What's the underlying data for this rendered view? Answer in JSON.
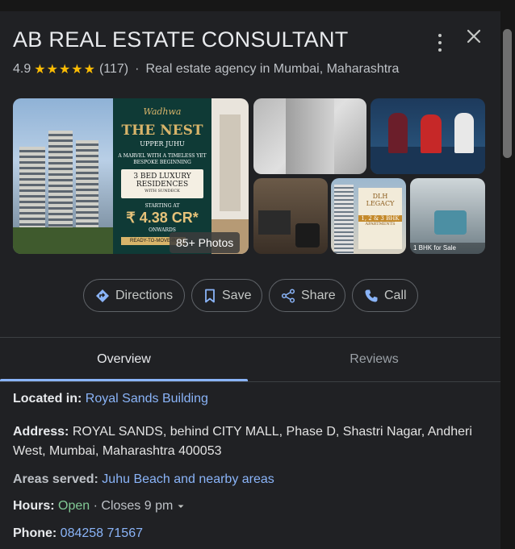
{
  "place": {
    "name": "AB REAL ESTATE CONSULTANT",
    "rating": "4.9",
    "stars": "★★★★★",
    "review_count": "(117)",
    "separator": "·",
    "category": "Real estate agency in Mumbai, Maharashtra"
  },
  "photos": {
    "count_label": "85+ Photos",
    "main": {
      "brand": "Wadhwa",
      "project": "THE NEST",
      "location": "UPPER JUHU",
      "tagline_1": "A MARVEL WITH A TIMELESS YET",
      "tagline_2": "BESPOKE BEGINNING",
      "box_line_1": "3 BED LUXURY",
      "box_line_2": "RESIDENCES",
      "box_line_3": "WITH SUNDECK",
      "starting_at": "STARTING AT",
      "price": "₹ 4.38 CR*",
      "onwards": "ONWARDS",
      "ready": "READY-TO-MOVE-IN"
    },
    "dlh": {
      "title_1": "DLH",
      "title_2": "LEGACY",
      "line": "1, 2 & 3 BHK",
      "sub": "APARTMENTS"
    },
    "room_caption": "1 BHK for Sale"
  },
  "actions": [
    {
      "label": "Directions",
      "icon": "directions-icon"
    },
    {
      "label": "Save",
      "icon": "bookmark-icon"
    },
    {
      "label": "Share",
      "icon": "share-icon"
    },
    {
      "label": "Call",
      "icon": "phone-icon"
    }
  ],
  "tabs": {
    "overview": "Overview",
    "reviews": "Reviews"
  },
  "details": {
    "located_in_label": "Located in:",
    "located_in_value": "Royal Sands Building",
    "address_label": "Address:",
    "address_value": "ROYAL SANDS, behind CITY MALL, Phase D, Shastri Nagar, Andheri West, Mumbai, Maharashtra 400053",
    "areas_label": "Areas served:",
    "areas_value": "Juhu Beach and nearby areas",
    "hours_label": "Hours:",
    "hours_status": "Open",
    "hours_sep": "·",
    "hours_close": "Closes 9 pm",
    "phone_label": "Phone:",
    "phone_value": "084258 71567"
  },
  "colors": {
    "background": "#202124",
    "link": "#8ab4f8",
    "open": "#81c995",
    "star": "#fbbc04"
  }
}
